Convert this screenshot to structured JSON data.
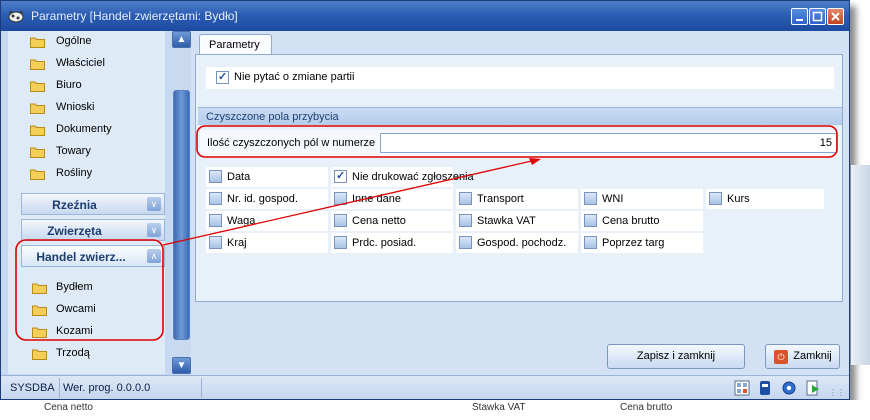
{
  "window": {
    "title": "Parametry [Handel zwierzętami: Bydło]"
  },
  "nav": {
    "items_top": [
      "Ogólne",
      "Właściciel",
      "Biuro",
      "Wnioski",
      "Dokumenty",
      "Towary",
      "Rośliny"
    ],
    "groups": [
      {
        "label": "Rzeźnia",
        "chevron": "double-chevron-down"
      },
      {
        "label": "Zwierzęta",
        "chevron": "double-chevron-down"
      },
      {
        "label": "Handel zwierz...",
        "chevron": "double-chevron-up"
      }
    ],
    "items_sub": [
      "Bydłem",
      "Owcami",
      "Kozami",
      "Trzodą"
    ]
  },
  "tabs": [
    {
      "label": "Parametry"
    }
  ],
  "params": {
    "no_ask_label": "Nie pytać o zmiane partii",
    "no_ask_checked": true
  },
  "cleared_fields": {
    "group_title": "Czyszczone pola przybycia",
    "count_label": "Ilość czyszczonych pól w numerze",
    "count_value": "15",
    "checkboxes": [
      {
        "label": "Data",
        "checked": false
      },
      {
        "label": "Nie drukować zgłoszenia",
        "checked": true
      },
      {
        "label": "Nr. id. gospod.",
        "checked": false
      },
      {
        "label": "Inne dane",
        "checked": false
      },
      {
        "label": "Transport",
        "checked": false
      },
      {
        "label": "WNI",
        "checked": false
      },
      {
        "label": "Kurs",
        "checked": false
      },
      {
        "label": "Waga",
        "checked": false
      },
      {
        "label": "Cena netto",
        "checked": false
      },
      {
        "label": "Stawka VAT",
        "checked": false
      },
      {
        "label": "Cena brutto",
        "checked": false
      },
      {
        "label": "Kraj",
        "checked": false
      },
      {
        "label": "Prdc. posiad.",
        "checked": false
      },
      {
        "label": "Gospod. pochodz.",
        "checked": false
      },
      {
        "label": "Poprzez targ",
        "checked": false
      }
    ]
  },
  "buttons": {
    "save": "Zapisz i zamknij",
    "close": "Zamknij"
  },
  "status": {
    "user": "SYSDBA",
    "version": "Wer. prog. 0.0.0.0"
  },
  "background": {
    "texts": [
      "Cena netto",
      "Stawka VAT",
      "Cena brutto"
    ]
  },
  "colors": {
    "annotation": "#e00000",
    "titlebar": "#2c5eb5",
    "accent": "#3b6bb6"
  }
}
